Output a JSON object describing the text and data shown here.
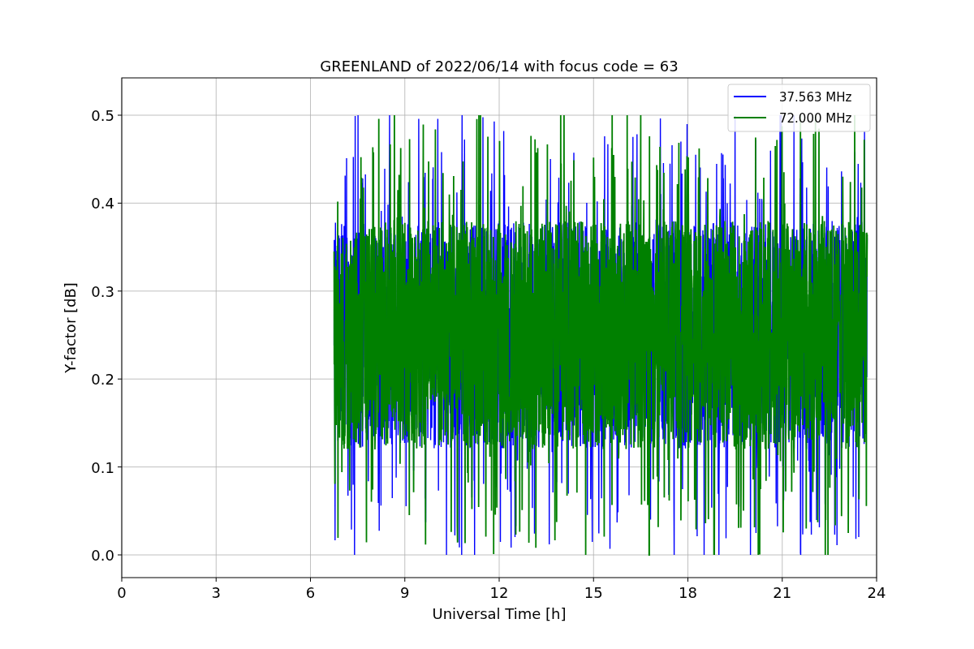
{
  "figure": {
    "title": "GREENLAND of 2022/06/14 with focus code = 63",
    "xlabel": "Universal Time [h]",
    "ylabel": "Y-factor [dB]",
    "xticks": [
      "0",
      "3",
      "6",
      "9",
      "12",
      "15",
      "18",
      "21",
      "24"
    ],
    "yticks": [
      "0.5",
      "0.4",
      "0.3",
      "0.2",
      "0.1",
      "0.0"
    ],
    "legend": [
      {
        "label": "37.563 MHz",
        "color": "#0000ff"
      },
      {
        "label": "72.000 MHz",
        "color": "#008000"
      }
    ]
  }
}
